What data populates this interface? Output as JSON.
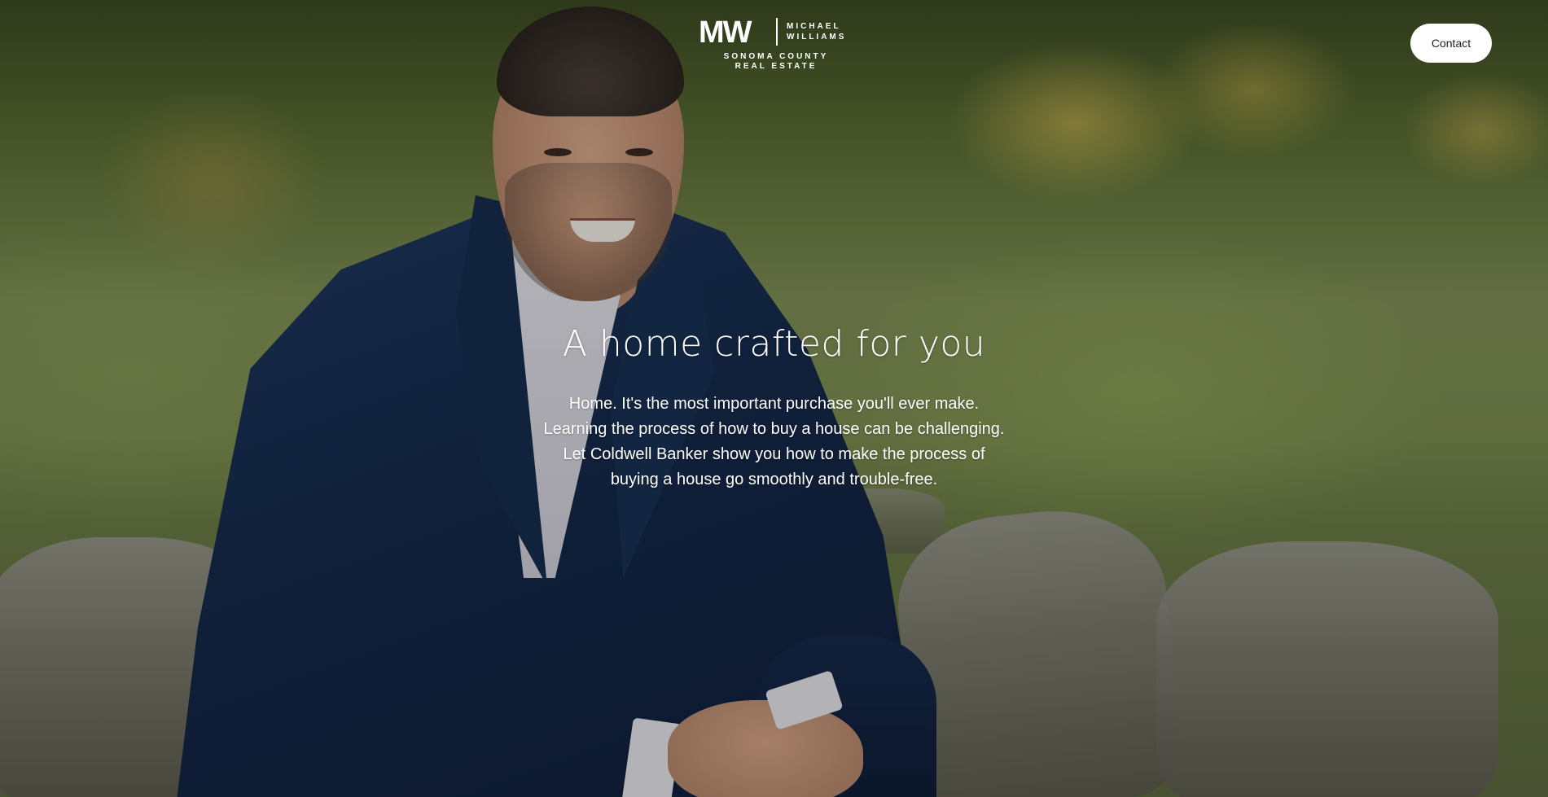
{
  "header": {
    "logo": {
      "mark": "MW",
      "name_line1": "MICHAEL",
      "name_line2": "WILLIAMS",
      "sub_line1": "SONOMA COUNTY",
      "sub_line2": "REAL ESTATE"
    },
    "contact_label": "Contact"
  },
  "hero": {
    "title": "A home crafted for you",
    "body_lines": [
      "Home. It's the most important purchase you'll ever make.",
      "Learning the process of how to buy a house can be challenging.",
      "Let Coldwell Banker show you how to make the process of",
      "buying a house go smoothly and trouble-free."
    ]
  },
  "colors": {
    "text": "#ffffff",
    "button_bg": "#ffffff",
    "button_text": "#222222"
  }
}
